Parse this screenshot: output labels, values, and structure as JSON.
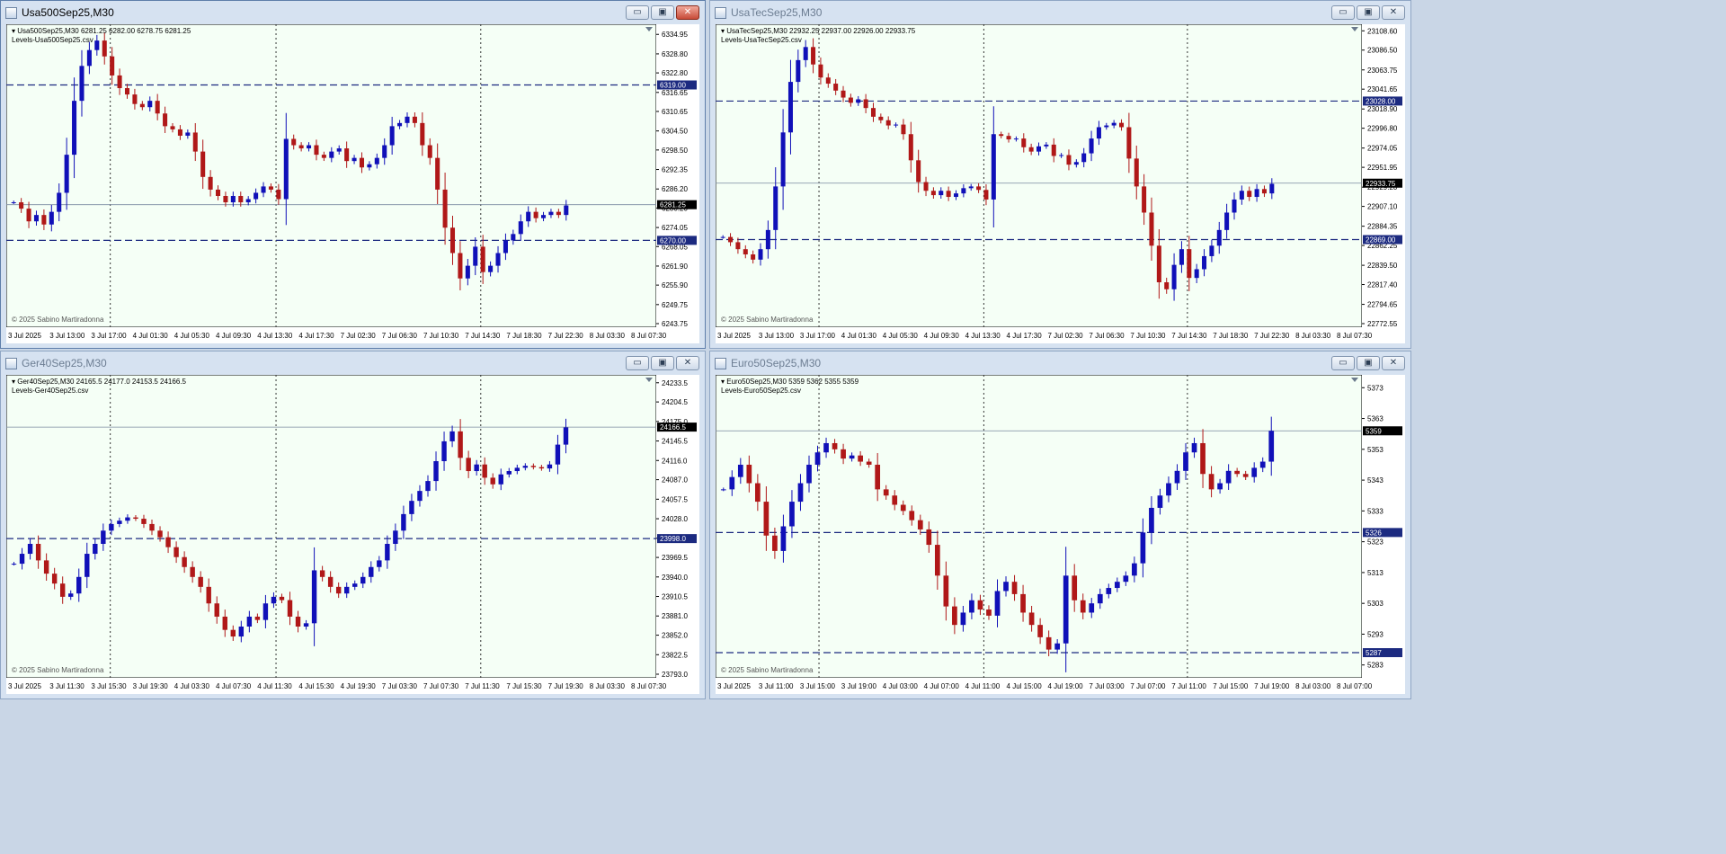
{
  "windows": [
    {
      "title": "Usa500Sep25,M30",
      "active": true,
      "symbol_line": "Usa500Sep25,M30  6281.25 6282.00 6278.75 6281.25",
      "indicator_line": "Levels-Usa500Sep25.csv",
      "copyright": "© 2025 Sabino Martiradonna",
      "buttons": {
        "minimize": "▭",
        "restore": "▣",
        "close": "✕"
      }
    },
    {
      "title": "UsaTecSep25,M30",
      "active": false,
      "symbol_line": "UsaTecSep25,M30  22932.25 22937.00 22926.00 22933.75",
      "indicator_line": "Levels-UsaTecSep25.csv",
      "copyright": "© 2025 Sabino Martiradonna",
      "buttons": {
        "minimize": "▭",
        "restore": "▣",
        "close": "✕"
      }
    },
    {
      "title": "Ger40Sep25,M30",
      "active": false,
      "symbol_line": "Ger40Sep25,M30  24165.5 24177.0 24153.5 24166.5",
      "indicator_line": "Levels-Ger40Sep25.csv",
      "copyright": "© 2025 Sabino Martiradonna",
      "buttons": {
        "minimize": "▭",
        "restore": "▣",
        "close": "✕"
      }
    },
    {
      "title": "Euro50Sep25,M30",
      "active": false,
      "symbol_line": "Euro50Sep25,M30  5359 5362 5355 5359",
      "indicator_line": "Levels-Euro50Sep25.csv",
      "copyright": "© 2025 Sabino Martiradonna",
      "buttons": {
        "minimize": "▭",
        "restore": "▣",
        "close": "✕"
      }
    }
  ],
  "chart_data": [
    {
      "type": "candlestick",
      "symbol": "Usa500Sep25",
      "timeframe": "M30",
      "ylim": [
        6243.75,
        6337.0
      ],
      "y_ticks": [
        "6334.95",
        "6328.80",
        "6322.80",
        "6316.65",
        "6310.65",
        "6304.50",
        "6298.50",
        "6292.35",
        "6286.20",
        "6280.20",
        "6274.05",
        "6268.05",
        "6261.90",
        "6255.90",
        "6249.75",
        "6243.75"
      ],
      "x_ticks": [
        "3 Jul 2025",
        "3 Jul 13:00",
        "3 Jul 17:00",
        "4 Jul 01:30",
        "4 Jul 05:30",
        "4 Jul 09:30",
        "4 Jul 13:30",
        "4 Jul 17:30",
        "7 Jul 02:30",
        "7 Jul 06:30",
        "7 Jul 10:30",
        "7 Jul 14:30",
        "7 Jul 18:30",
        "7 Jul 22:30",
        "8 Jul 03:30",
        "8 Jul 07:30"
      ],
      "levels": [
        {
          "value": 6319.0,
          "label": "6319.00",
          "style": "dash-navy"
        },
        {
          "value": 6270.0,
          "label": "6270.00",
          "style": "dash-navy"
        }
      ],
      "current_price": {
        "value": 6281.25,
        "label": "6281.25"
      },
      "closes": [
        6282,
        6280,
        6276,
        6278,
        6275,
        6279,
        6285,
        6297,
        6314,
        6325,
        6330,
        6333,
        6328,
        6322,
        6318,
        6316,
        6313,
        6312,
        6314,
        6310,
        6306,
        6305,
        6303,
        6304,
        6298,
        6290,
        6286,
        6284,
        6282,
        6284,
        6282,
        6283,
        6285,
        6287,
        6286,
        6283,
        6302,
        6300,
        6299,
        6300,
        6297,
        6296,
        6298,
        6299,
        6295,
        6296,
        6293,
        6294,
        6296,
        6300,
        6306,
        6307,
        6309,
        6307,
        6300,
        6296,
        6286,
        6274,
        6266,
        6258,
        6262,
        6268,
        6260,
        6262,
        6266,
        6270,
        6272,
        6276,
        6279,
        6277,
        6278,
        6279,
        6278,
        6281
      ]
    },
    {
      "type": "candlestick",
      "symbol": "UsaTecSep25",
      "timeframe": "M30",
      "ylim": [
        22772.55,
        23112.0
      ],
      "y_ticks": [
        "23108.60",
        "23086.50",
        "23063.75",
        "23041.65",
        "23018.90",
        "22996.80",
        "22974.05",
        "22951.95",
        "22929.20",
        "22907.10",
        "22884.35",
        "22862.25",
        "22839.50",
        "22817.40",
        "22794.65",
        "22772.55"
      ],
      "x_ticks": [
        "3 Jul 2025",
        "3 Jul 13:00",
        "3 Jul 17:00",
        "4 Jul 01:30",
        "4 Jul 05:30",
        "4 Jul 09:30",
        "4 Jul 13:30",
        "4 Jul 17:30",
        "7 Jul 02:30",
        "7 Jul 06:30",
        "7 Jul 10:30",
        "7 Jul 14:30",
        "7 Jul 18:30",
        "7 Jul 22:30",
        "8 Jul 03:30",
        "8 Jul 07:30"
      ],
      "levels": [
        {
          "value": 23028.0,
          "label": "23028.00",
          "style": "dash-navy"
        },
        {
          "value": 22869.0,
          "label": "22869.00",
          "style": "dash-navy"
        }
      ],
      "current_price": {
        "value": 22933.75,
        "label": "22933.75"
      },
      "closes": [
        22872,
        22866,
        22858,
        22852,
        22846,
        22858,
        22880,
        22930,
        22992,
        23050,
        23075,
        23090,
        23070,
        23055,
        23048,
        23040,
        23032,
        23026,
        23030,
        23020,
        23010,
        23006,
        23000,
        23001,
        22990,
        22960,
        22935,
        22925,
        22920,
        22925,
        22918,
        22922,
        22928,
        22930,
        22926,
        22915,
        22990,
        22988,
        22984,
        22985,
        22975,
        22970,
        22976,
        22978,
        22965,
        22966,
        22955,
        22958,
        22968,
        22985,
        22998,
        23000,
        23003,
        22998,
        22962,
        22930,
        22900,
        22862,
        22820,
        22812,
        22840,
        22858,
        22825,
        22835,
        22850,
        22862,
        22880,
        22900,
        22915,
        22925,
        22918,
        22927,
        22922,
        22933
      ]
    },
    {
      "type": "candlestick",
      "symbol": "Ger40Sep25",
      "timeframe": "M30",
      "ylim": [
        23793.0,
        24240.0
      ],
      "y_ticks": [
        "24233.5",
        "24204.5",
        "24175.0",
        "24145.5",
        "24116.0",
        "24087.0",
        "24057.5",
        "24028.0",
        "23998.5",
        "23969.5",
        "23940.0",
        "23910.5",
        "23881.0",
        "23852.0",
        "23822.5",
        "23793.0"
      ],
      "x_ticks": [
        "3 Jul 2025",
        "3 Jul 11:30",
        "3 Jul 15:30",
        "3 Jul 19:30",
        "4 Jul 03:30",
        "4 Jul 07:30",
        "4 Jul 11:30",
        "4 Jul 15:30",
        "4 Jul 19:30",
        "7 Jul 03:30",
        "7 Jul 07:30",
        "7 Jul 11:30",
        "7 Jul 15:30",
        "7 Jul 19:30",
        "8 Jul 03:30",
        "8 Jul 07:30"
      ],
      "levels": [
        {
          "value": 23998.0,
          "label": "23998.0",
          "style": "dash-navy"
        }
      ],
      "current_price": {
        "value": 24166.5,
        "label": "24166.5"
      },
      "closes": [
        23960,
        23975,
        23990,
        23965,
        23945,
        23930,
        23910,
        23915,
        23940,
        23975,
        23990,
        24010,
        24020,
        24025,
        24030,
        24028,
        24020,
        24010,
        24000,
        23985,
        23970,
        23955,
        23940,
        23925,
        23900,
        23880,
        23860,
        23850,
        23865,
        23880,
        23875,
        23900,
        23910,
        23905,
        23880,
        23865,
        23870,
        23950,
        23940,
        23925,
        23915,
        23925,
        23930,
        23940,
        23955,
        23965,
        23990,
        24010,
        24035,
        24055,
        24070,
        24085,
        24115,
        24145,
        24160,
        24120,
        24100,
        24110,
        24090,
        24080,
        24095,
        24100,
        24105,
        24108,
        24106,
        24104,
        24110,
        24140,
        24166
      ]
    },
    {
      "type": "candlestick",
      "symbol": "Euro50Sep25",
      "timeframe": "M30",
      "ylim": [
        5280.0,
        5376.0
      ],
      "y_ticks": [
        "5373",
        "5363",
        "5353",
        "5343",
        "5333",
        "5323",
        "5313",
        "5303",
        "5293",
        "5283"
      ],
      "x_ticks": [
        "3 Jul 2025",
        "3 Jul 11:00",
        "3 Jul 15:00",
        "3 Jul 19:00",
        "4 Jul 03:00",
        "4 Jul 07:00",
        "4 Jul 11:00",
        "4 Jul 15:00",
        "4 Jul 19:00",
        "7 Jul 03:00",
        "7 Jul 07:00",
        "7 Jul 11:00",
        "7 Jul 15:00",
        "7 Jul 19:00",
        "8 Jul 03:00",
        "8 Jul 07:00"
      ],
      "levels": [
        {
          "value": 5326.0,
          "label": "5326",
          "style": "dash-navy"
        },
        {
          "value": 5287.0,
          "label": "5287",
          "style": "dash-navy"
        }
      ],
      "current_price": {
        "value": 5359.0,
        "label": "5359"
      },
      "closes": [
        5340,
        5344,
        5348,
        5342,
        5336,
        5325,
        5320,
        5328,
        5336,
        5342,
        5348,
        5352,
        5355,
        5353,
        5350,
        5351,
        5349,
        5348,
        5340,
        5338,
        5335,
        5333,
        5330,
        5327,
        5322,
        5312,
        5302,
        5296,
        5300,
        5304,
        5301,
        5299,
        5307,
        5310,
        5306,
        5300,
        5296,
        5292,
        5288,
        5290,
        5312,
        5304,
        5300,
        5303,
        5306,
        5308,
        5310,
        5312,
        5316,
        5326,
        5334,
        5338,
        5342,
        5346,
        5352,
        5355,
        5345,
        5340,
        5342,
        5346,
        5345,
        5344,
        5347,
        5349,
        5359
      ]
    }
  ]
}
